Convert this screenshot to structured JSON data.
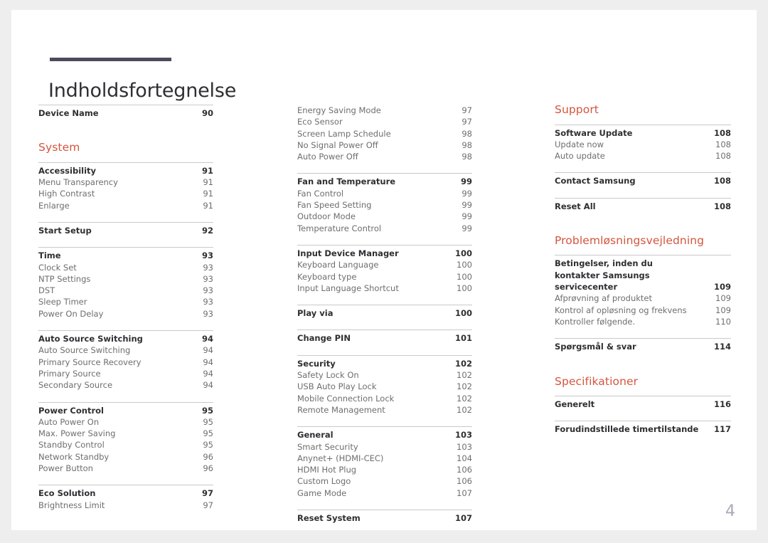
{
  "document": {
    "title": "Indholdsfortegnelse",
    "folio": "4",
    "accent_color": "#d4553d",
    "rule_color": "#c9c9c9",
    "title_bar_color": "#4b4b5c",
    "page_background": "#ffffff",
    "canvas_background": "#eeeeee"
  },
  "columns": [
    {
      "name": "column-1",
      "blocks": [
        {
          "type": "group",
          "rule": true,
          "entries": [
            {
              "label": "Device Name",
              "page": "90",
              "level": 1
            }
          ]
        },
        {
          "type": "spacer",
          "size": "lg"
        },
        {
          "type": "heading",
          "text": "System"
        },
        {
          "type": "spacer",
          "size": "heading"
        },
        {
          "type": "group",
          "rule": true,
          "entries": [
            {
              "label": "Accessibility",
              "page": "91",
              "level": 1
            },
            {
              "label": "Menu Transparency",
              "page": "91",
              "level": 2
            },
            {
              "label": "High Contrast",
              "page": "91",
              "level": 2
            },
            {
              "label": "Enlarge",
              "page": "91",
              "level": 2
            }
          ]
        },
        {
          "type": "spacer",
          "size": "sm"
        },
        {
          "type": "group",
          "rule": true,
          "entries": [
            {
              "label": "Start Setup",
              "page": "92",
              "level": 1
            }
          ]
        },
        {
          "type": "spacer",
          "size": "sm"
        },
        {
          "type": "group",
          "rule": true,
          "entries": [
            {
              "label": "Time",
              "page": "93",
              "level": 1
            },
            {
              "label": "Clock Set",
              "page": "93",
              "level": 2
            },
            {
              "label": "NTP Settings",
              "page": "93",
              "level": 2
            },
            {
              "label": "DST",
              "page": "93",
              "level": 2
            },
            {
              "label": "Sleep Timer",
              "page": "93",
              "level": 2
            },
            {
              "label": "Power On Delay",
              "page": "93",
              "level": 2
            }
          ]
        },
        {
          "type": "spacer",
          "size": "sm"
        },
        {
          "type": "group",
          "rule": true,
          "entries": [
            {
              "label": "Auto Source Switching",
              "page": "94",
              "level": 1
            },
            {
              "label": "Auto Source Switching",
              "page": "94",
              "level": 2
            },
            {
              "label": "Primary Source Recovery",
              "page": "94",
              "level": 2
            },
            {
              "label": "Primary Source",
              "page": "94",
              "level": 2
            },
            {
              "label": "Secondary Source",
              "page": "94",
              "level": 2
            }
          ]
        },
        {
          "type": "spacer",
          "size": "sm"
        },
        {
          "type": "group",
          "rule": true,
          "entries": [
            {
              "label": "Power Control",
              "page": "95",
              "level": 1
            },
            {
              "label": "Auto Power On",
              "page": "95",
              "level": 2
            },
            {
              "label": "Max. Power Saving",
              "page": "95",
              "level": 2
            },
            {
              "label": "Standby Control",
              "page": "95",
              "level": 2
            },
            {
              "label": "Network Standby",
              "page": "96",
              "level": 2
            },
            {
              "label": "Power Button",
              "page": "96",
              "level": 2
            }
          ]
        },
        {
          "type": "spacer",
          "size": "sm"
        },
        {
          "type": "group",
          "rule": true,
          "entries": [
            {
              "label": "Eco Solution",
              "page": "97",
              "level": 1
            },
            {
              "label": "Brightness Limit",
              "page": "97",
              "level": 2
            }
          ]
        }
      ]
    },
    {
      "name": "column-2",
      "blocks": [
        {
          "type": "group",
          "rule": false,
          "entries": [
            {
              "label": "Energy Saving Mode",
              "page": "97",
              "level": 2
            },
            {
              "label": "Eco Sensor",
              "page": "97",
              "level": 2
            },
            {
              "label": "Screen Lamp Schedule",
              "page": "98",
              "level": 2
            },
            {
              "label": "No Signal Power Off",
              "page": "98",
              "level": 2
            },
            {
              "label": "Auto Power Off",
              "page": "98",
              "level": 2
            }
          ]
        },
        {
          "type": "spacer",
          "size": "sm"
        },
        {
          "type": "group",
          "rule": true,
          "entries": [
            {
              "label": "Fan and Temperature",
              "page": "99",
              "level": 1
            },
            {
              "label": "Fan Control",
              "page": "99",
              "level": 2
            },
            {
              "label": "Fan Speed Setting",
              "page": "99",
              "level": 2
            },
            {
              "label": "Outdoor Mode",
              "page": "99",
              "level": 2
            },
            {
              "label": "Temperature Control",
              "page": "99",
              "level": 2
            }
          ]
        },
        {
          "type": "spacer",
          "size": "sm"
        },
        {
          "type": "group",
          "rule": true,
          "entries": [
            {
              "label": "Input Device Manager",
              "page": "100",
              "level": 1
            },
            {
              "label": "Keyboard Language",
              "page": "100",
              "level": 2
            },
            {
              "label": "Keyboard type",
              "page": "100",
              "level": 2
            },
            {
              "label": "Input Language Shortcut",
              "page": "100",
              "level": 2
            }
          ]
        },
        {
          "type": "spacer",
          "size": "sm"
        },
        {
          "type": "group",
          "rule": true,
          "entries": [
            {
              "label": "Play via",
              "page": "100",
              "level": 1
            }
          ]
        },
        {
          "type": "spacer",
          "size": "sm"
        },
        {
          "type": "group",
          "rule": true,
          "entries": [
            {
              "label": "Change PIN",
              "page": "101",
              "level": 1
            }
          ]
        },
        {
          "type": "spacer",
          "size": "sm"
        },
        {
          "type": "group",
          "rule": true,
          "entries": [
            {
              "label": "Security",
              "page": "102",
              "level": 1
            },
            {
              "label": "Safety Lock On",
              "page": "102",
              "level": 2
            },
            {
              "label": "USB Auto Play Lock",
              "page": "102",
              "level": 2
            },
            {
              "label": "Mobile Connection Lock",
              "page": "102",
              "level": 2
            },
            {
              "label": "Remote Management",
              "page": "102",
              "level": 2
            }
          ]
        },
        {
          "type": "spacer",
          "size": "sm"
        },
        {
          "type": "group",
          "rule": true,
          "entries": [
            {
              "label": "General",
              "page": "103",
              "level": 1
            },
            {
              "label": "Smart Security",
              "page": "103",
              "level": 2
            },
            {
              "label": "Anynet+ (HDMI-CEC)",
              "page": "104",
              "level": 2
            },
            {
              "label": "HDMI Hot Plug",
              "page": "106",
              "level": 2
            },
            {
              "label": "Custom Logo",
              "page": "106",
              "level": 2
            },
            {
              "label": "Game Mode",
              "page": "107",
              "level": 2
            }
          ]
        },
        {
          "type": "spacer",
          "size": "sm"
        },
        {
          "type": "group",
          "rule": true,
          "entries": [
            {
              "label": "Reset System",
              "page": "107",
              "level": 1
            }
          ]
        }
      ]
    },
    {
      "name": "column-3",
      "blocks": [
        {
          "type": "heading",
          "text": "Support"
        },
        {
          "type": "spacer",
          "size": "heading"
        },
        {
          "type": "group",
          "rule": true,
          "entries": [
            {
              "label": "Software Update",
              "page": "108",
              "level": 1
            },
            {
              "label": "Update now",
              "page": "108",
              "level": 2
            },
            {
              "label": "Auto update",
              "page": "108",
              "level": 2
            }
          ]
        },
        {
          "type": "spacer",
          "size": "sm"
        },
        {
          "type": "group",
          "rule": true,
          "entries": [
            {
              "label": "Contact Samsung",
              "page": "108",
              "level": 1
            }
          ]
        },
        {
          "type": "spacer",
          "size": "sm"
        },
        {
          "type": "group",
          "rule": true,
          "entries": [
            {
              "label": "Reset All",
              "page": "108",
              "level": 1
            }
          ]
        },
        {
          "type": "spacer",
          "size": "lg"
        },
        {
          "type": "heading",
          "text": "Problemløsningsvejledning"
        },
        {
          "type": "spacer",
          "size": "heading"
        },
        {
          "type": "group",
          "rule": true,
          "entries": [
            {
              "label": "Betingelser, inden du kontakter Samsungs servicecenter",
              "page": "109",
              "level": 1,
              "wrap": true
            },
            {
              "label": "Afprøvning af produktet",
              "page": "109",
              "level": 2
            },
            {
              "label": "Kontrol af opløsning og frekvens",
              "page": "109",
              "level": 2
            },
            {
              "label": "Kontroller følgende.",
              "page": "110",
              "level": 2
            }
          ]
        },
        {
          "type": "spacer",
          "size": "sm"
        },
        {
          "type": "group",
          "rule": true,
          "entries": [
            {
              "label": "Spørgsmål & svar",
              "page": "114",
              "level": 1
            }
          ]
        },
        {
          "type": "spacer",
          "size": "lg"
        },
        {
          "type": "heading",
          "text": "Specifikationer"
        },
        {
          "type": "spacer",
          "size": "heading"
        },
        {
          "type": "group",
          "rule": true,
          "entries": [
            {
              "label": "Generelt",
              "page": "116",
              "level": 1
            }
          ]
        },
        {
          "type": "spacer",
          "size": "sm"
        },
        {
          "type": "group",
          "rule": true,
          "entries": [
            {
              "label": "Forudindstillede timertilstande",
              "page": "117",
              "level": 1
            }
          ]
        }
      ]
    }
  ]
}
